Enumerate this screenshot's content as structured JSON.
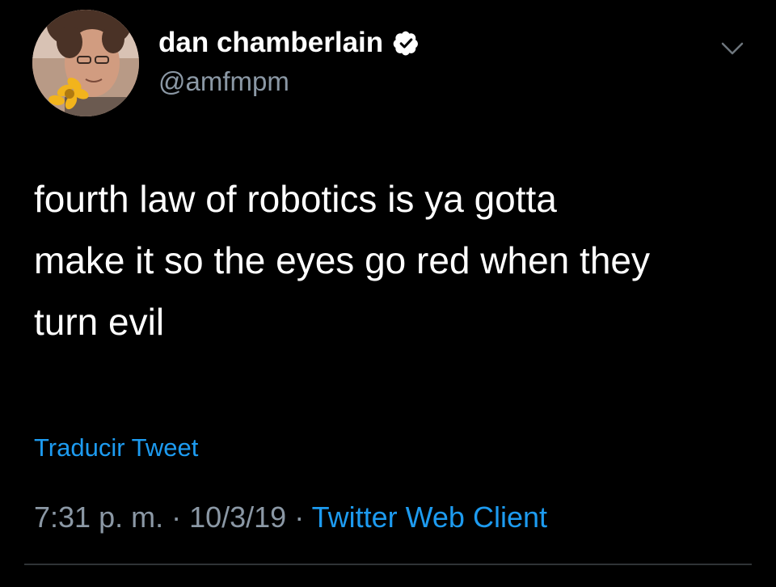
{
  "tweet": {
    "user": {
      "display_name": "dan chamberlain",
      "handle": "@amfmpm",
      "verified_icon": "verified-badge-icon",
      "avatar": "profile-photo"
    },
    "more_icon": "chevron-down-icon",
    "text": "fourth law of robotics is ya gotta\nmake it so the eyes go red when they\nturn evil",
    "translate_label": "Traducir Tweet",
    "meta": {
      "time": "7:31 p. m.",
      "separator": " · ",
      "date": "10/3/19",
      "client": "Twitter Web Client"
    }
  },
  "colors": {
    "background": "#000000",
    "text": "#ffffff",
    "secondary": "#8b98a5",
    "accent": "#1d9bf0",
    "divider": "#2f3336"
  }
}
